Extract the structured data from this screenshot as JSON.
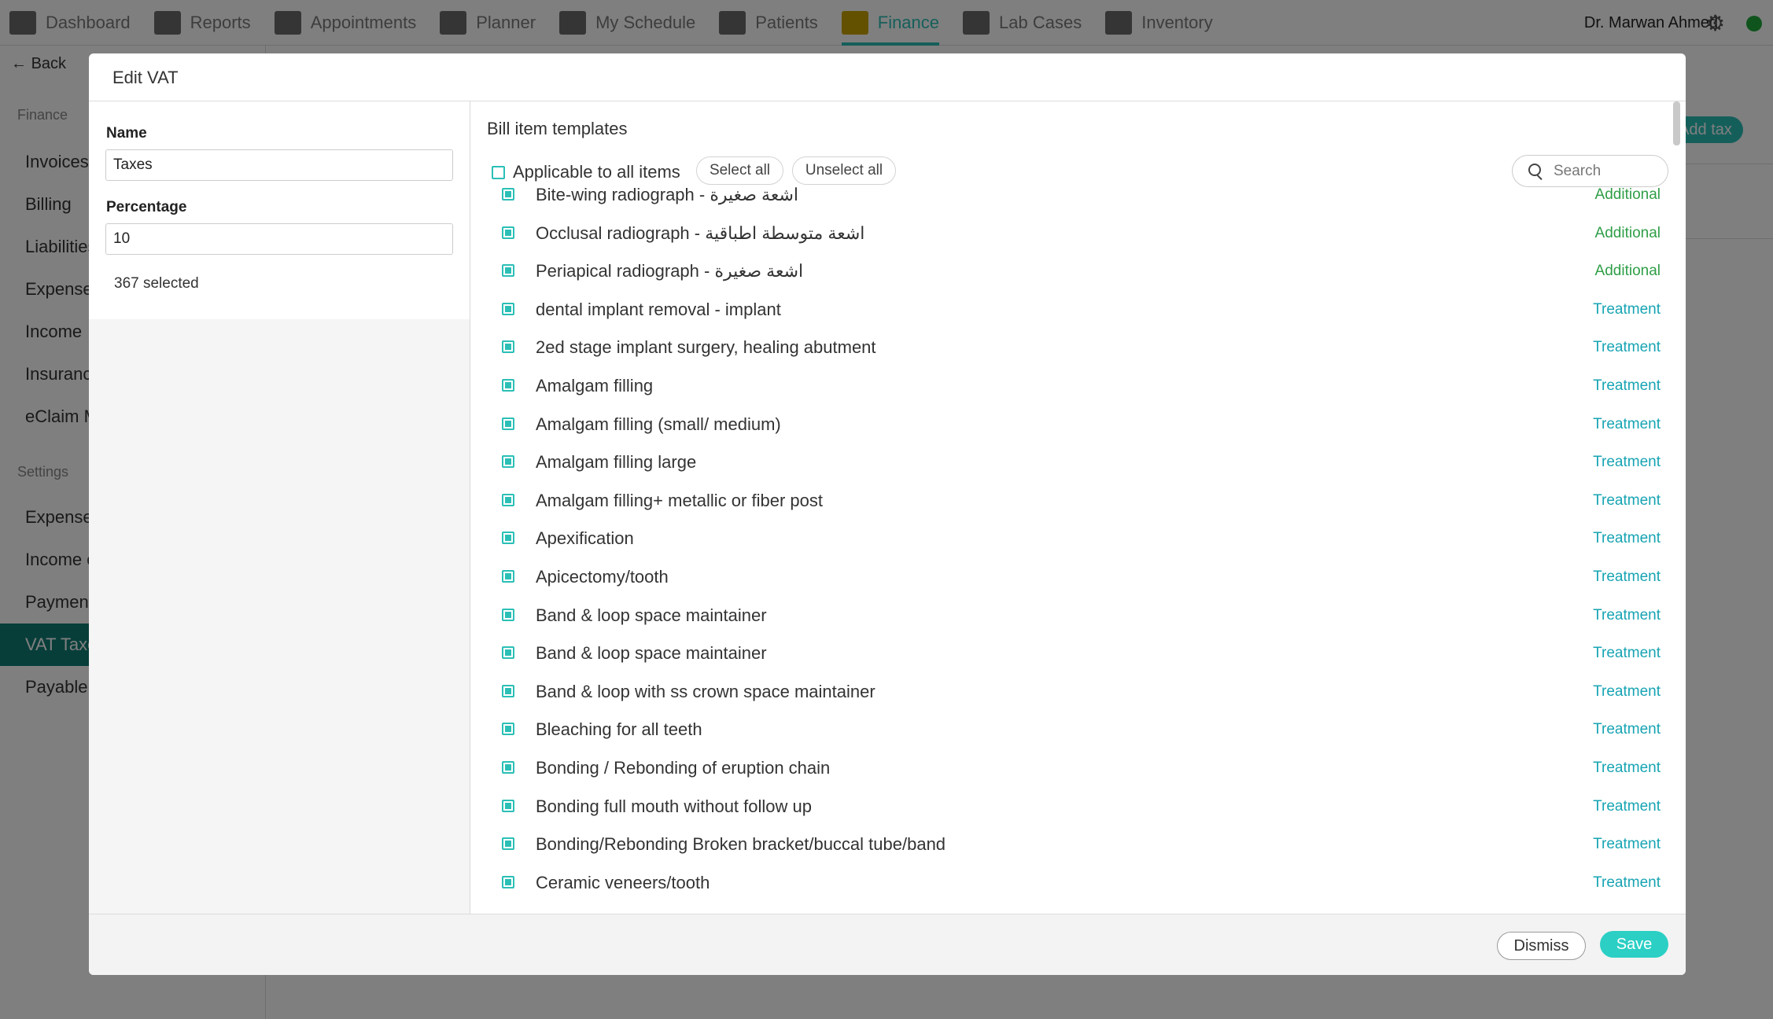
{
  "nav": {
    "items": [
      {
        "label": "Dashboard",
        "icon": "dashboard-icon"
      },
      {
        "label": "Reports",
        "icon": "bar-chart-icon"
      },
      {
        "label": "Appointments",
        "icon": "calendar-icon"
      },
      {
        "label": "Planner",
        "icon": "planner-icon"
      },
      {
        "label": "My Schedule",
        "icon": "schedule-icon"
      },
      {
        "label": "Patients",
        "icon": "users-icon"
      },
      {
        "label": "Finance",
        "icon": "calculator-icon"
      },
      {
        "label": "Lab Cases",
        "icon": "users-icon"
      },
      {
        "label": "Inventory",
        "icon": "users-icon"
      }
    ],
    "active": "Finance",
    "user_name": "Dr. Marwan Ahmed",
    "gear_icon": "⚙",
    "status_color": "#1ea839"
  },
  "sidebar": {
    "back_label": "Back",
    "finance_heading": "Finance",
    "finance_items": [
      "Invoices",
      "Billing",
      "Liabilities",
      "Expenses",
      "Income",
      "Insurance",
      "eClaim M"
    ],
    "settings_heading": "Settings",
    "settings_items": [
      "Expense",
      "Income c",
      "Payment",
      "VAT Taxes",
      "Payable"
    ],
    "active_item": "VAT Taxes"
  },
  "background": {
    "add_tax_label": "Add tax"
  },
  "modal": {
    "title": "Edit VAT",
    "name_label": "Name",
    "name_value": "Taxes",
    "percentage_label": "Percentage",
    "percentage_value": "10",
    "selected_text": "367 selected",
    "section_title": "Bill item templates",
    "applicable_label": "Applicable to all items",
    "select_all_label": "Select all",
    "unselect_all_label": "Unselect all",
    "search_placeholder": "Search",
    "items": [
      {
        "name": "Bite-wing radiograph - اشعة صغيرة",
        "type": "Additional"
      },
      {
        "name": "Occlusal radiograph - اشعة متوسطة اطباقية",
        "type": "Additional"
      },
      {
        "name": "Periapical radiograph - اشعة صغيرة",
        "type": "Additional"
      },
      {
        "name": "dental implant removal - implant",
        "type": "Treatment"
      },
      {
        "name": "2ed stage implant surgery, healing abutment",
        "type": "Treatment"
      },
      {
        "name": "Amalgam filling",
        "type": "Treatment"
      },
      {
        "name": "Amalgam filling (small/ medium)",
        "type": "Treatment"
      },
      {
        "name": "Amalgam filling large",
        "type": "Treatment"
      },
      {
        "name": "Amalgam filling+ metallic or fiber post",
        "type": "Treatment"
      },
      {
        "name": "Apexification",
        "type": "Treatment"
      },
      {
        "name": "Apicectomy/tooth",
        "type": "Treatment"
      },
      {
        "name": "Band & loop space maintainer",
        "type": "Treatment"
      },
      {
        "name": "Band & loop space maintainer",
        "type": "Treatment"
      },
      {
        "name": "Band & loop with ss crown space maintainer",
        "type": "Treatment"
      },
      {
        "name": "Bleaching for all teeth",
        "type": "Treatment"
      },
      {
        "name": "Bonding / Rebonding of eruption chain",
        "type": "Treatment"
      },
      {
        "name": "Bonding full mouth without follow up",
        "type": "Treatment"
      },
      {
        "name": "Bonding/Rebonding Broken bracket/buccal tube/band",
        "type": "Treatment"
      },
      {
        "name": "Ceramic veneers/tooth",
        "type": "Treatment"
      }
    ],
    "dismiss_label": "Dismiss",
    "save_label": "Save"
  }
}
